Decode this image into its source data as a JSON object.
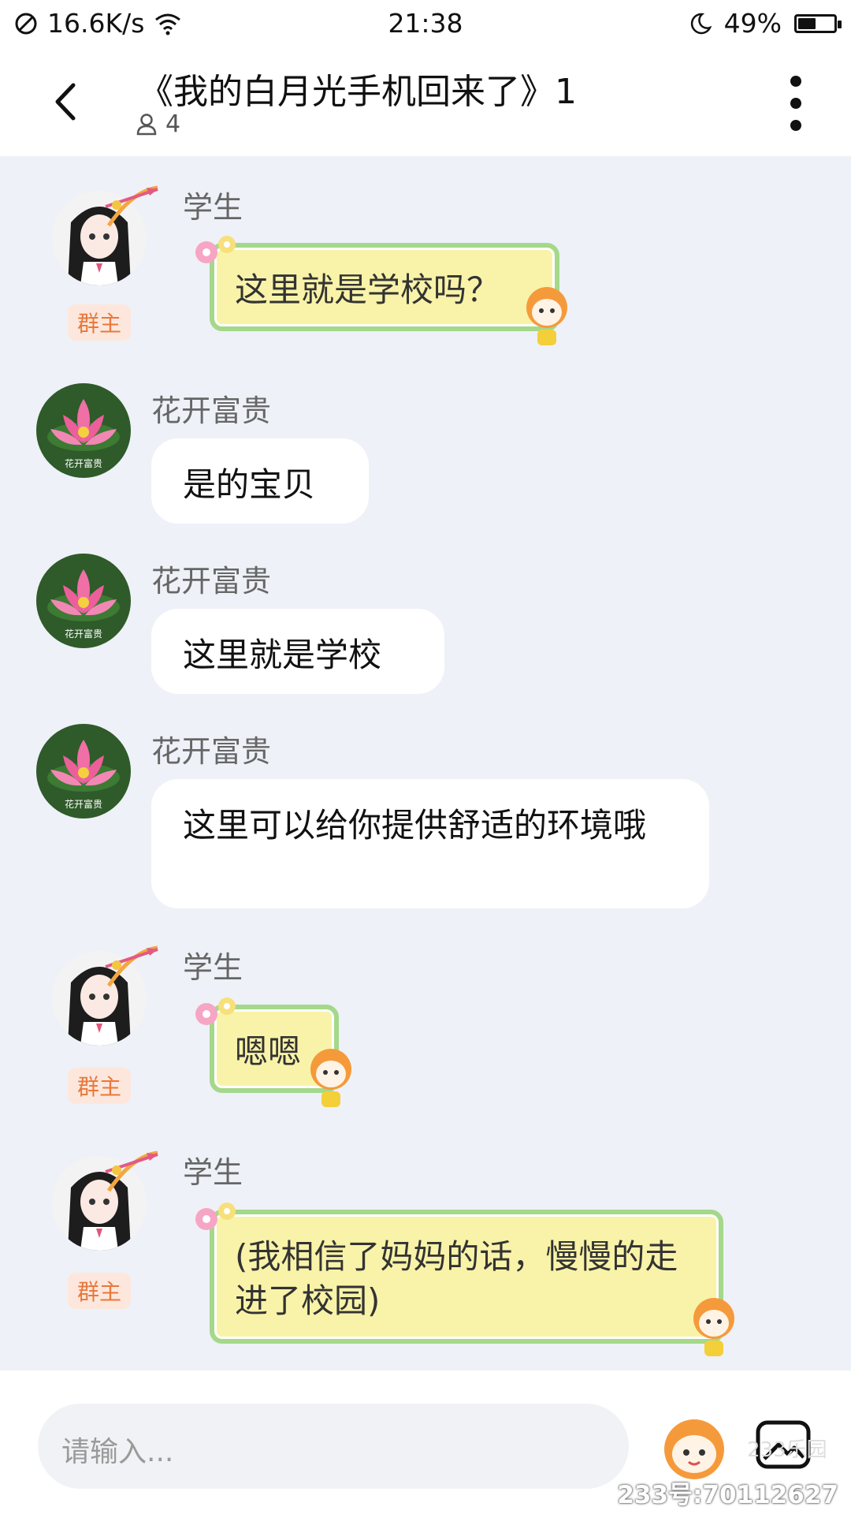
{
  "status_bar": {
    "net_speed": "16.6K/s",
    "time": "21:38",
    "battery": "49%",
    "battery_level": 0.49
  },
  "header": {
    "title": "《我的白月光手机回来了》1",
    "member_count": "4"
  },
  "messages": [
    {
      "sender": "学生",
      "badge": "群主",
      "text": "这里就是学校吗？",
      "style": "sticker"
    },
    {
      "sender": "花开富贵",
      "avatar_text": "花开富贵",
      "text": "是的宝贝",
      "style": "plain"
    },
    {
      "sender": "花开富贵",
      "avatar_text": "花开富贵",
      "text": "这里就是学校",
      "style": "plain"
    },
    {
      "sender": "花开富贵",
      "avatar_text": "花开富贵",
      "text": "这里可以给你提供舒适的环境哦",
      "style": "plain"
    },
    {
      "sender": "学生",
      "badge": "群主",
      "text": "嗯嗯",
      "style": "sticker"
    },
    {
      "sender": "学生",
      "badge": "群主",
      "text": "(我相信了妈妈的话，慢慢的走进了校园)",
      "style": "sticker"
    }
  ],
  "input": {
    "placeholder": "请输入..."
  },
  "watermark": "233号:70112627",
  "watermark_logo": "233乐园",
  "icons": [
    "no-sim-icon",
    "wifi-icon",
    "moon-icon",
    "battery-icon",
    "back-arrow-icon",
    "person-icon",
    "more-vertical-icon",
    "mascot-emoji-icon",
    "image-icon"
  ]
}
